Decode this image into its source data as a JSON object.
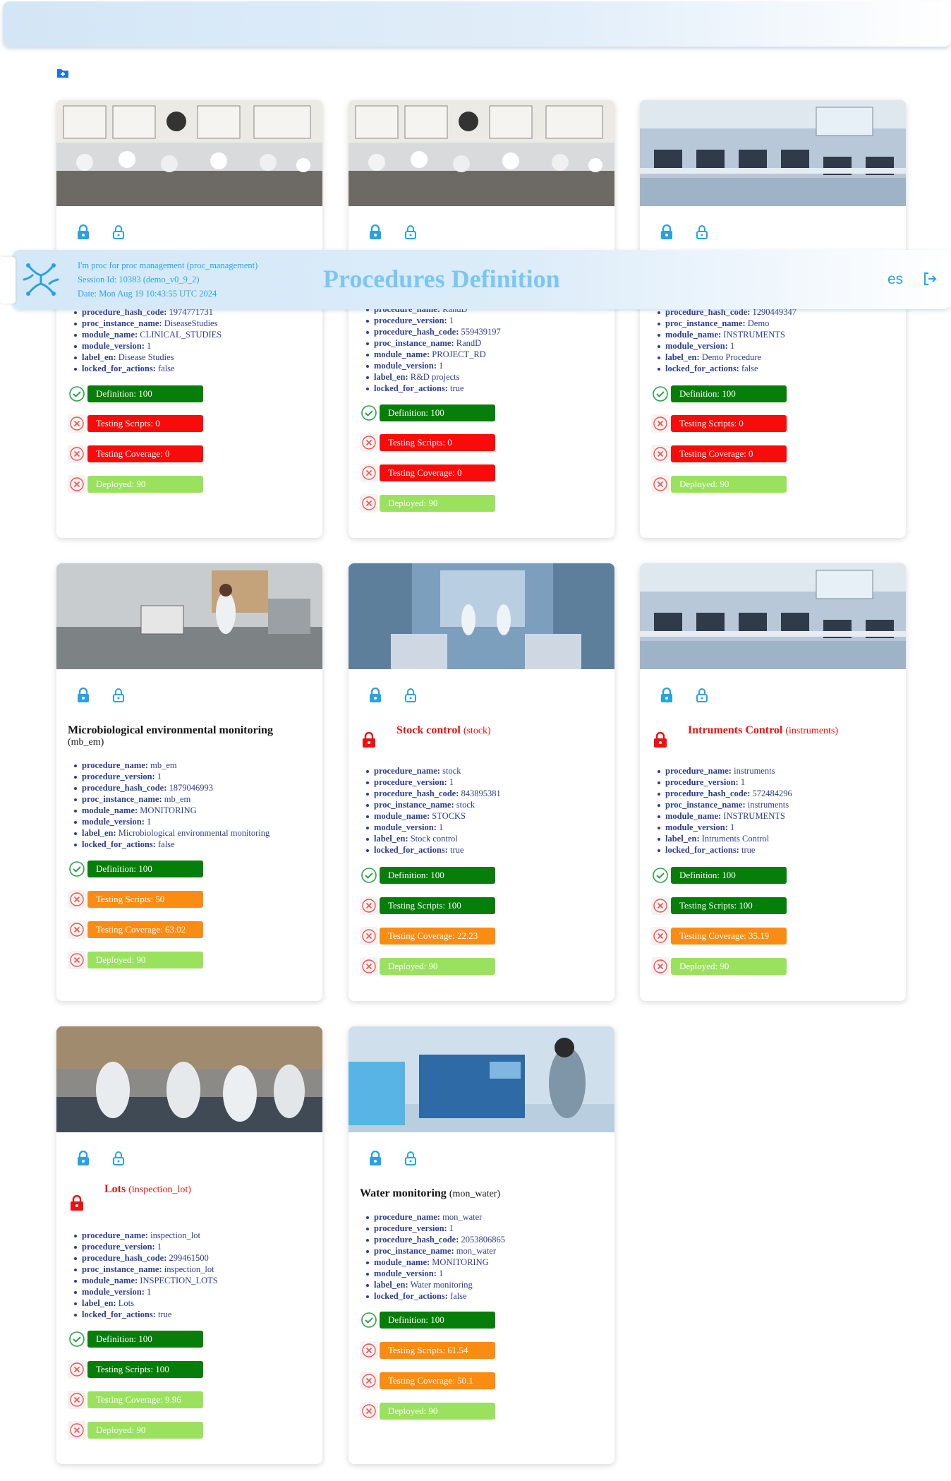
{
  "header": {
    "app_line": "I'm proc for proc management (proc_management)",
    "session": "Session Id: 10383 (demo_v0_9_2)",
    "date": "Date: Mon Aug 19 10:43:55 UTC 2024",
    "title": "Procedures Definition",
    "lang": "es",
    "icons": {
      "logo": "molecule-logo-icon",
      "logout": "logout-icon",
      "add": "add-folder-icon"
    }
  },
  "cards": [
    {
      "title": "",
      "code": "",
      "locked_title": false,
      "props": [
        {
          "k": "procedure_hash_code:",
          "v": "1974771731"
        },
        {
          "k": "proc_instance_name:",
          "v": "DiseaseStudies"
        },
        {
          "k": "module_name:",
          "v": "CLINICAL_STUDIES"
        },
        {
          "k": "module_version:",
          "v": "1"
        },
        {
          "k": "label_en:",
          "v": "Disease Studies"
        },
        {
          "k": "locked_for_actions:",
          "v": "false"
        }
      ],
      "statuses": [
        {
          "label": "Definition: 100",
          "ok": true,
          "color": "#067e09"
        },
        {
          "label": "Testing Scripts: 0",
          "ok": false,
          "color": "#f80b0b"
        },
        {
          "label": "Testing Coverage: 0",
          "ok": false,
          "color": "#f80b0b"
        },
        {
          "label": "Deployed: 90",
          "ok": false,
          "color": "#9ae25d"
        }
      ]
    },
    {
      "title": "",
      "code": "",
      "locked_title": false,
      "props": [
        {
          "k": "procedure_name:",
          "v": "RandD"
        },
        {
          "k": "procedure_version:",
          "v": "1"
        },
        {
          "k": "procedure_hash_code:",
          "v": "559439197"
        },
        {
          "k": "proc_instance_name:",
          "v": "RandD"
        },
        {
          "k": "module_name:",
          "v": "PROJECT_RD"
        },
        {
          "k": "module_version:",
          "v": "1"
        },
        {
          "k": "label_en:",
          "v": "R&D projects"
        },
        {
          "k": "locked_for_actions:",
          "v": "true"
        }
      ],
      "statuses": [
        {
          "label": "Definition: 100",
          "ok": true,
          "color": "#067e09"
        },
        {
          "label": "Testing Scripts: 0",
          "ok": false,
          "color": "#f80b0b"
        },
        {
          "label": "Testing Coverage: 0",
          "ok": false,
          "color": "#f80b0b"
        },
        {
          "label": "Deployed: 90",
          "ok": false,
          "color": "#9ae25d"
        }
      ]
    },
    {
      "title": "",
      "code": "",
      "locked_title": false,
      "props": [
        {
          "k": "procedure_hash_code:",
          "v": "1290449347"
        },
        {
          "k": "proc_instance_name:",
          "v": "Demo"
        },
        {
          "k": "module_name:",
          "v": "INSTRUMENTS"
        },
        {
          "k": "module_version:",
          "v": "1"
        },
        {
          "k": "label_en:",
          "v": "Demo Procedure"
        },
        {
          "k": "locked_for_actions:",
          "v": "false"
        }
      ],
      "statuses": [
        {
          "label": "Definition: 100",
          "ok": true,
          "color": "#067e09"
        },
        {
          "label": "Testing Scripts: 0",
          "ok": false,
          "color": "#f80b0b"
        },
        {
          "label": "Testing Coverage: 0",
          "ok": false,
          "color": "#f80b0b"
        },
        {
          "label": "Deployed: 90",
          "ok": false,
          "color": "#9ae25d"
        }
      ]
    },
    {
      "title": "Microbiological environmental monitoring",
      "code": "(mb_em)",
      "locked_title": false,
      "props": [
        {
          "k": "procedure_name:",
          "v": "mb_em"
        },
        {
          "k": "procedure_version:",
          "v": "1"
        },
        {
          "k": "procedure_hash_code:",
          "v": "1879046993"
        },
        {
          "k": "proc_instance_name:",
          "v": "mb_em"
        },
        {
          "k": "module_name:",
          "v": "MONITORING"
        },
        {
          "k": "module_version:",
          "v": "1"
        },
        {
          "k": "label_en:",
          "v": "Microbiological environmental monitoring"
        },
        {
          "k": "locked_for_actions:",
          "v": "false"
        }
      ],
      "statuses": [
        {
          "label": "Definition: 100",
          "ok": true,
          "color": "#067e09"
        },
        {
          "label": "Testing Scripts: 50",
          "ok": false,
          "color": "#fa8c13"
        },
        {
          "label": "Testing Coverage: 63.02",
          "ok": false,
          "color": "#fa8c13"
        },
        {
          "label": "Deployed: 90",
          "ok": false,
          "color": "#9ae25d"
        }
      ]
    },
    {
      "title": "Stock control",
      "code": "(stock)",
      "locked_title": true,
      "props": [
        {
          "k": "procedure_name:",
          "v": "stock"
        },
        {
          "k": "procedure_version:",
          "v": "1"
        },
        {
          "k": "procedure_hash_code:",
          "v": "843895381"
        },
        {
          "k": "proc_instance_name:",
          "v": "stock"
        },
        {
          "k": "module_name:",
          "v": "STOCKS"
        },
        {
          "k": "module_version:",
          "v": "1"
        },
        {
          "k": "label_en:",
          "v": "Stock control"
        },
        {
          "k": "locked_for_actions:",
          "v": "true"
        }
      ],
      "statuses": [
        {
          "label": "Definition: 100",
          "ok": true,
          "color": "#067e09"
        },
        {
          "label": "Testing Scripts: 100",
          "ok": false,
          "color": "#067e09"
        },
        {
          "label": "Testing Coverage: 22.23",
          "ok": false,
          "color": "#fa8c13"
        },
        {
          "label": "Deployed: 90",
          "ok": false,
          "color": "#9ae25d"
        }
      ]
    },
    {
      "title": "Intruments Control",
      "code": "(instruments)",
      "locked_title": true,
      "props": [
        {
          "k": "procedure_name:",
          "v": "instruments"
        },
        {
          "k": "procedure_version:",
          "v": "1"
        },
        {
          "k": "procedure_hash_code:",
          "v": "572484296"
        },
        {
          "k": "proc_instance_name:",
          "v": "instruments"
        },
        {
          "k": "module_name:",
          "v": "INSTRUMENTS"
        },
        {
          "k": "module_version:",
          "v": "1"
        },
        {
          "k": "label_en:",
          "v": "Intruments Control"
        },
        {
          "k": "locked_for_actions:",
          "v": "true"
        }
      ],
      "statuses": [
        {
          "label": "Definition: 100",
          "ok": true,
          "color": "#067e09"
        },
        {
          "label": "Testing Scripts: 100",
          "ok": false,
          "color": "#067e09"
        },
        {
          "label": "Testing Coverage: 35.19",
          "ok": false,
          "color": "#fa8c13"
        },
        {
          "label": "Deployed: 90",
          "ok": false,
          "color": "#9ae25d"
        }
      ]
    },
    {
      "title": "Lots",
      "code": "(inspection_lot)",
      "locked_title": true,
      "props": [
        {
          "k": "procedure_name:",
          "v": "inspection_lot"
        },
        {
          "k": "procedure_version:",
          "v": "1"
        },
        {
          "k": "procedure_hash_code:",
          "v": "299461500"
        },
        {
          "k": "proc_instance_name:",
          "v": "inspection_lot"
        },
        {
          "k": "module_name:",
          "v": "INSPECTION_LOTS"
        },
        {
          "k": "module_version:",
          "v": "1"
        },
        {
          "k": "label_en:",
          "v": "Lots"
        },
        {
          "k": "locked_for_actions:",
          "v": "true"
        }
      ],
      "statuses": [
        {
          "label": "Definition: 100",
          "ok": true,
          "color": "#067e09"
        },
        {
          "label": "Testing Scripts: 100",
          "ok": false,
          "color": "#067e09"
        },
        {
          "label": "Testing Coverage: 9.96",
          "ok": false,
          "color": "#9ae25d"
        },
        {
          "label": "Deployed: 90",
          "ok": false,
          "color": "#9ae25d"
        }
      ]
    },
    {
      "title": "Water monitoring",
      "code": "(mon_water)",
      "locked_title": false,
      "props": [
        {
          "k": "procedure_name:",
          "v": "mon_water"
        },
        {
          "k": "procedure_version:",
          "v": "1"
        },
        {
          "k": "procedure_hash_code:",
          "v": "2053806865"
        },
        {
          "k": "proc_instance_name:",
          "v": "mon_water"
        },
        {
          "k": "module_name:",
          "v": "MONITORING"
        },
        {
          "k": "module_version:",
          "v": "1"
        },
        {
          "k": "label_en:",
          "v": "Water monitoring"
        },
        {
          "k": "locked_for_actions:",
          "v": "false"
        }
      ],
      "statuses": [
        {
          "label": "Definition: 100",
          "ok": true,
          "color": "#067e09"
        },
        {
          "label": "Testing Scripts: 61.54",
          "ok": false,
          "color": "#fa8c13"
        },
        {
          "label": "Testing Coverage: 50.1",
          "ok": false,
          "color": "#fa8c13"
        },
        {
          "label": "Deployed: 90",
          "ok": false,
          "color": "#9ae25d"
        }
      ]
    }
  ]
}
